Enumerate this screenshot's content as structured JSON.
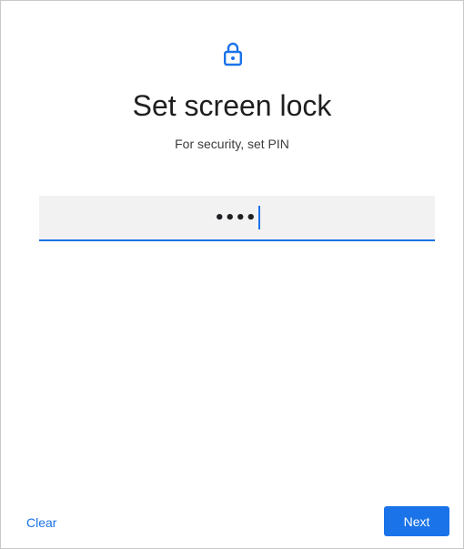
{
  "header": {
    "lock_icon": "lock-icon",
    "title": "Set screen lock",
    "subtitle": "For security, set PIN"
  },
  "pin_input": {
    "value": "••••"
  },
  "footer": {
    "clear_label": "Clear",
    "next_label": "Next"
  },
  "colors": {
    "accent": "#1a73e8",
    "field_background": "#f2f2f2",
    "title_text": "#1f1f1f"
  }
}
